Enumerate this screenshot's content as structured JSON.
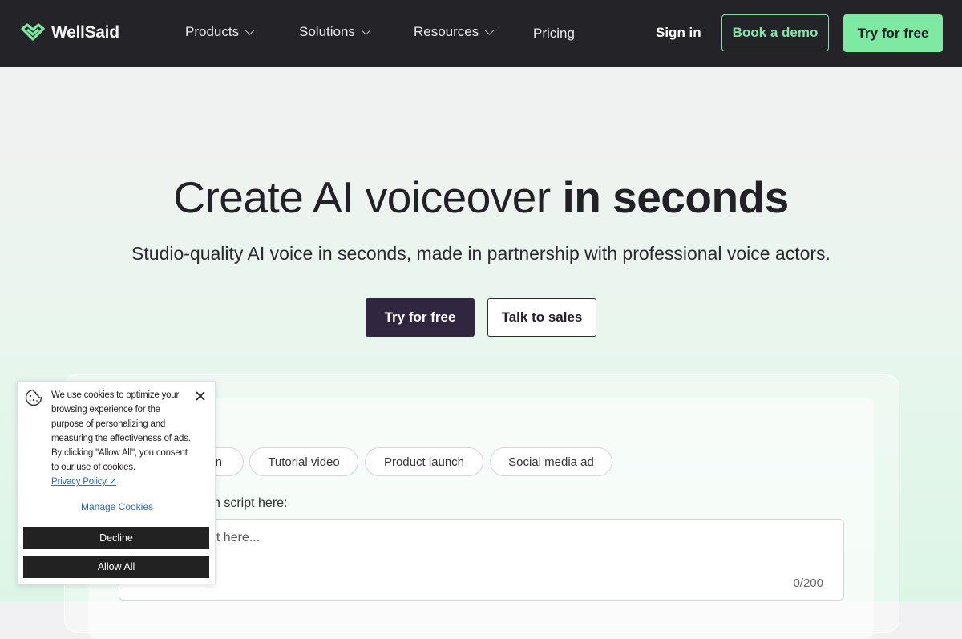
{
  "nav": {
    "brand": "WellSaid",
    "items": [
      {
        "label": "Products"
      },
      {
        "label": "Solutions"
      },
      {
        "label": "Resources"
      },
      {
        "label": "Pricing"
      }
    ],
    "sign_in": "Sign in",
    "book_demo": "Book a demo",
    "try_free": "Try for free"
  },
  "hero": {
    "title_regular": "Create AI voiceover ",
    "title_bold": "in seconds",
    "subtitle": "Studio-quality AI voice in seconds, made in partnership with professional voice actors.",
    "primary_cta": "Try for free",
    "secondary_cta": "Talk to sales"
  },
  "demo": {
    "chips": [
      {
        "label": "n"
      },
      {
        "label": "Tutorial video"
      },
      {
        "label": "Product launch"
      },
      {
        "label": "Social media ad"
      }
    ],
    "script_label": "vn script here:",
    "script_placeholder": "pt here...",
    "char_count": "0/200"
  },
  "cookie": {
    "text": "We use cookies to optimize your browsing experience for the purpose of personalizing and measuring the effectiveness of ads. By clicking \"Allow All\", you consent to our use of cookies.",
    "privacy_link": "Privacy Policy ↗",
    "manage": "Manage Cookies",
    "decline": "Decline",
    "allow_all": "Allow All"
  },
  "colors": {
    "nav_bg": "#242328",
    "accent_green": "#7ee9a1",
    "primary_dark": "#30263f"
  }
}
